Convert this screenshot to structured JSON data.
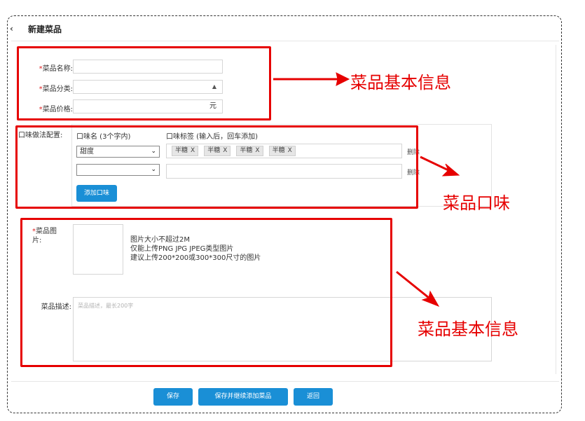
{
  "header": {
    "back_icon": "‹",
    "title": "新建菜品"
  },
  "basic_info": {
    "name_label": "菜品名称:",
    "category_label": "菜品分类:",
    "price_label": "菜品价格:",
    "price_unit": "元",
    "required_mark": "*"
  },
  "flavor": {
    "section_label": "口味做法配置:",
    "name_header": "口味名 (3个字内)",
    "tags_header": "口味标签 (输入后，回车添加)",
    "rows": [
      {
        "selected": "甜度",
        "tags": [
          "半糖",
          "半糖",
          "半糖",
          "半糖"
        ],
        "delete_label": "删除"
      },
      {
        "selected": "",
        "tags": [],
        "delete_label": "删除"
      }
    ],
    "tag_close": "X",
    "add_button": "添加口味"
  },
  "image": {
    "label_line1": "菜品图",
    "label_line2": "片:",
    "hint1": "图片大小不超过2M",
    "hint2": "仅能上传PNG JPG JPEG类型图片",
    "hint3": "建议上传200*200或300*300尺寸的图片"
  },
  "description": {
    "label": "菜品描述:",
    "placeholder": "菜品描述，最长200字"
  },
  "footer": {
    "save": "保存",
    "save_continue": "保存并继续添加菜品",
    "back": "返回"
  },
  "annotations": {
    "basic_info": "菜品基本信息",
    "flavor": "菜品口味",
    "basic_info_2": "菜品基本信息",
    "color": "#e60000"
  },
  "colors": {
    "primary_button": "#1a8fd6",
    "required": "#e02020"
  }
}
